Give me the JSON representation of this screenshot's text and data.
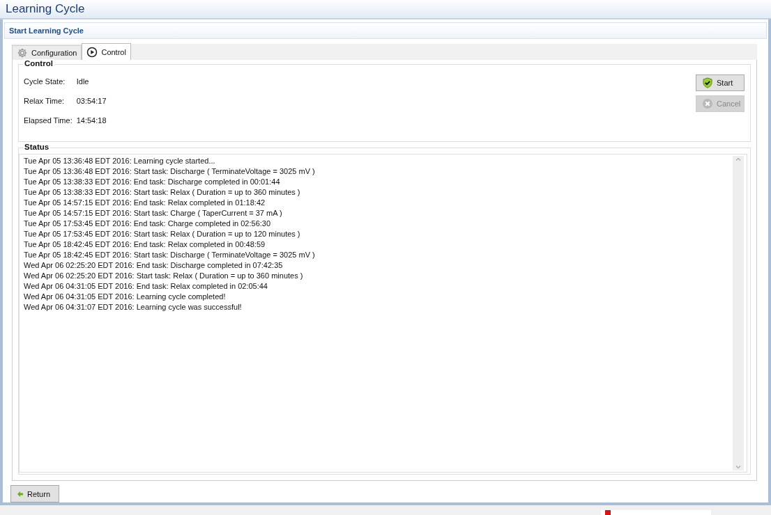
{
  "window": {
    "title": "Learning Cycle"
  },
  "section": {
    "title": "Start Learning Cycle"
  },
  "tabs": [
    {
      "label": "Configuration",
      "kind": "gear",
      "selected": false
    },
    {
      "label": "Control",
      "kind": "play",
      "selected": true
    }
  ],
  "control": {
    "title": "Control",
    "fields": [
      {
        "label": "Cycle State:",
        "value": "Idle"
      },
      {
        "label": "Relax Time:",
        "value": "03:54:17"
      },
      {
        "label": "Elapsed Time:",
        "value": "14:54:18"
      }
    ],
    "buttons": [
      {
        "label": "Start",
        "kind": "start",
        "disabled": false
      },
      {
        "label": "Cancel",
        "kind": "cancel",
        "disabled": true
      }
    ]
  },
  "status": {
    "title": "Status",
    "lines": [
      "Tue Apr 05 13:36:48 EDT 2016: Learning cycle started...",
      "Tue Apr 05 13:36:48 EDT 2016: Start task: Discharge ( TerminateVoltage = 3025 mV )",
      "Tue Apr 05 13:38:33 EDT 2016: End task: Discharge completed in 00:01:44",
      "Tue Apr 05 13:38:33 EDT 2016: Start task: Relax ( Duration = up to 360 minutes )",
      "Tue Apr 05 14:57:15 EDT 2016: End task: Relax completed in 01:18:42",
      "Tue Apr 05 14:57:15 EDT 2016: Start task: Charge ( TaperCurrent = 37 mA )",
      "Tue Apr 05 17:53:45 EDT 2016: End task: Charge completed in 02:56:30",
      "Tue Apr 05 17:53:45 EDT 2016: Start task: Relax ( Duration = up to 120 minutes )",
      "Tue Apr 05 18:42:45 EDT 2016: End task: Relax completed in 00:48:59",
      "Tue Apr 05 18:42:45 EDT 2016: Start task: Discharge ( TerminateVoltage = 3025 mV )",
      "Wed Apr 06 02:25:20 EDT 2016: End task: Discharge completed in 07:42:35",
      "Wed Apr 06 02:25:20 EDT 2016: Start task: Relax ( Duration = up to 360 minutes )",
      "Wed Apr 06 04:31:05 EDT 2016: End task: Relax completed in 02:05:44",
      "Wed Apr 06 04:31:05 EDT 2016: Learning cycle completed!",
      "Wed Apr 06 04:31:07 EDT 2016: Learning cycle was successful!"
    ]
  },
  "return_button": {
    "label": "Return"
  }
}
